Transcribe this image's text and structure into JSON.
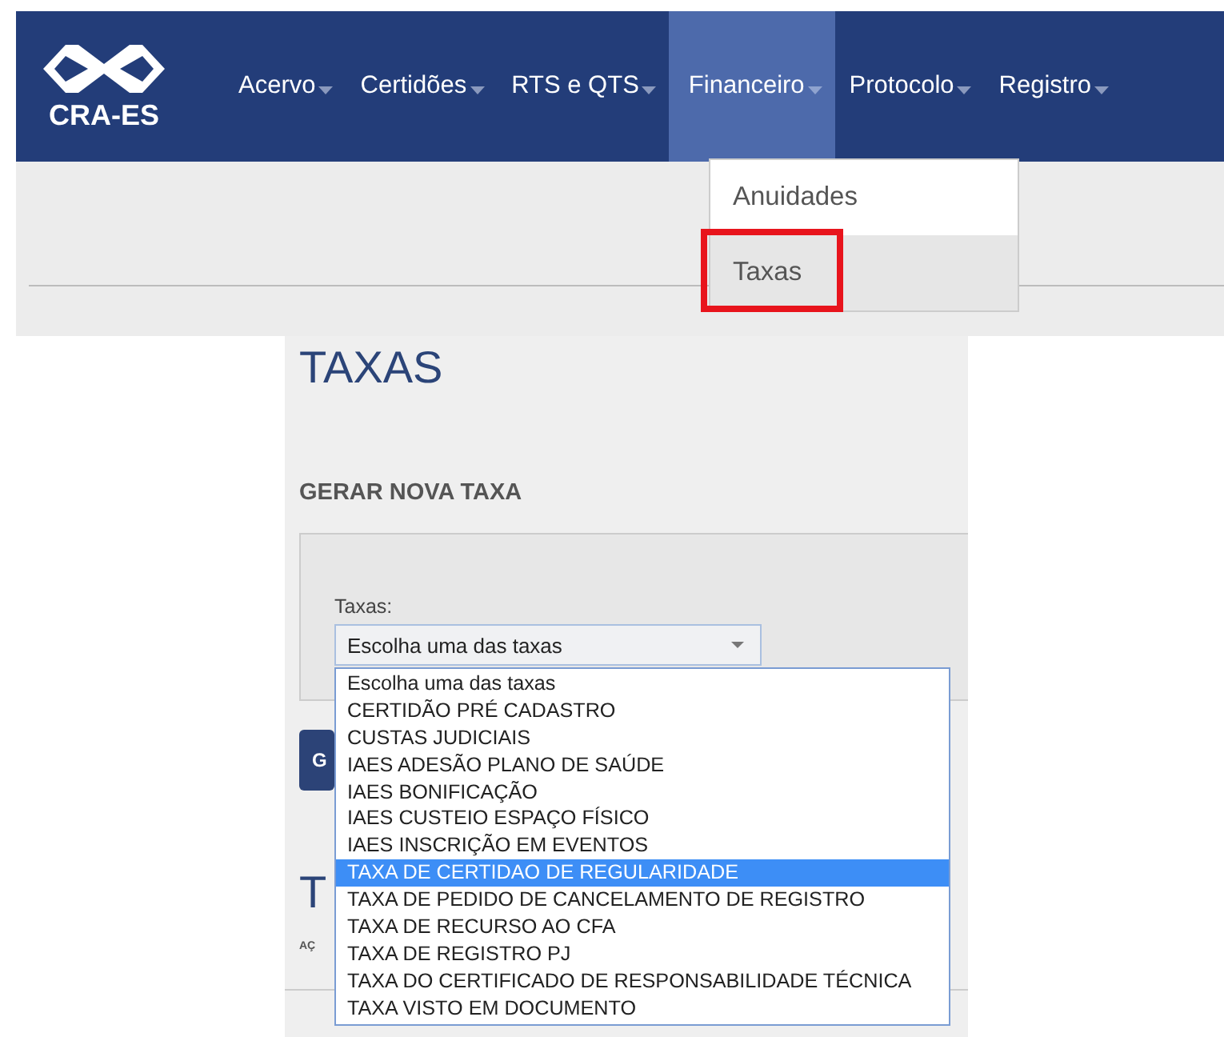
{
  "nav": {
    "logo": "CRA-ES",
    "items": [
      {
        "label": "Acervo",
        "selected": false
      },
      {
        "label": "Certidões",
        "selected": false
      },
      {
        "label": "RTS e QTS",
        "selected": false
      },
      {
        "label": "Financeiro",
        "selected": true
      },
      {
        "label": "Protocolo",
        "selected": false
      },
      {
        "label": "Registro",
        "selected": false
      }
    ]
  },
  "submenu": {
    "items": [
      {
        "label": "Anuidades",
        "selected": false,
        "annotated": false
      },
      {
        "label": "Taxas",
        "selected": true,
        "annotated": true
      }
    ]
  },
  "page": {
    "title": "TAXAS",
    "section": "GERAR NOVA TAXA",
    "field_label": "Taxas:",
    "select_value": "Escolha uma das taxas",
    "button": "G",
    "heading_2": "T",
    "column_1": "AÇ",
    "options": [
      {
        "label": "Escolha uma das taxas",
        "selected": false
      },
      {
        "label": "CERTIDÃO PRÉ CADASTRO",
        "selected": false
      },
      {
        "label": "CUSTAS JUDICIAIS",
        "selected": false
      },
      {
        "label": "IAES ADESÃO PLANO DE SAÚDE",
        "selected": false
      },
      {
        "label": "IAES BONIFICAÇÃO",
        "selected": false
      },
      {
        "label": "IAES CUSTEIO ESPAÇO FÍSICO",
        "selected": false
      },
      {
        "label": "IAES INSCRIÇÃO EM EVENTOS",
        "selected": false
      },
      {
        "label": "TAXA DE CERTIDAO DE REGULARIDADE",
        "selected": true
      },
      {
        "label": "TAXA DE PEDIDO DE CANCELAMENTO DE REGISTRO",
        "selected": false
      },
      {
        "label": "TAXA DE RECURSO AO CFA",
        "selected": false
      },
      {
        "label": "TAXA DE REGISTRO PJ",
        "selected": false
      },
      {
        "label": "TAXA DO CERTIFICADO DE RESPONSABILIDADE TÉCNICA",
        "selected": false
      },
      {
        "label": "TAXA VISTO EM DOCUMENTO",
        "selected": false
      }
    ]
  }
}
